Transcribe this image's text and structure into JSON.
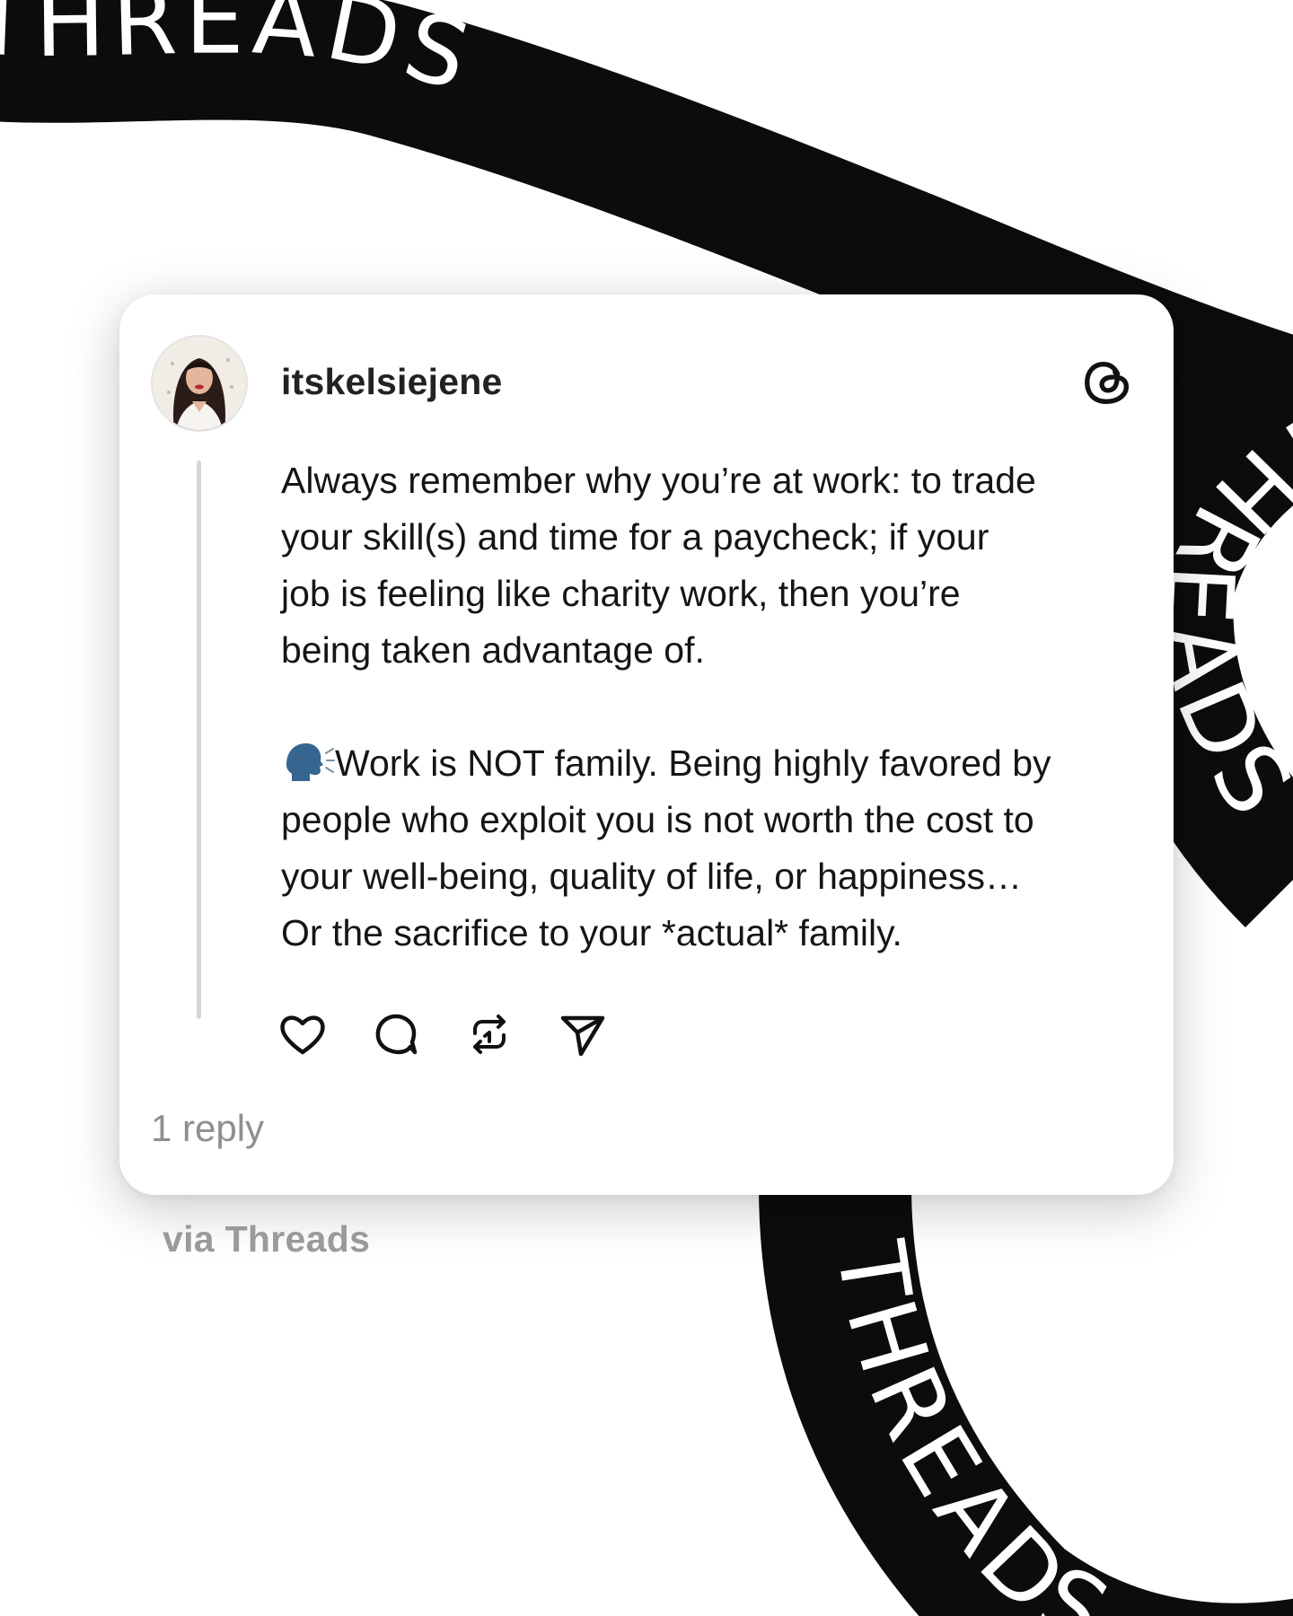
{
  "background": {
    "ribbon_words": [
      "THREADS",
      "THREADS",
      "THREADS",
      "THREADS"
    ],
    "ribbon_color": "#0c0c0c",
    "text_color": "#ffffff"
  },
  "post": {
    "username": "itskelsiejene",
    "avatar_icon": "profile-photo",
    "brand_icon": "threads-logo",
    "paragraph_1": "Always remember why you’re at work: to trade\nyour skill(s) and time for a paycheck; if your\njob is feeling like charity work, then you’re\nbeing taken advantage of.",
    "paragraph_2_emoji": "speaking-head-icon",
    "paragraph_2": "Work is NOT family. Being highly favored by\npeople who exploit you is not worth the cost to\nyour well-being, quality of life, or happiness…\nOr the sacrifice to your *actual* family.",
    "actions": [
      "heart-icon",
      "comment-icon",
      "repost-icon",
      "share-icon"
    ],
    "reply_count": "1 reply"
  },
  "footer": {
    "via": "via Threads"
  },
  "colors": {
    "card": "#ffffff",
    "text": "#151515",
    "muted": "#8f8f8f",
    "divider": "#d6d6d6"
  }
}
